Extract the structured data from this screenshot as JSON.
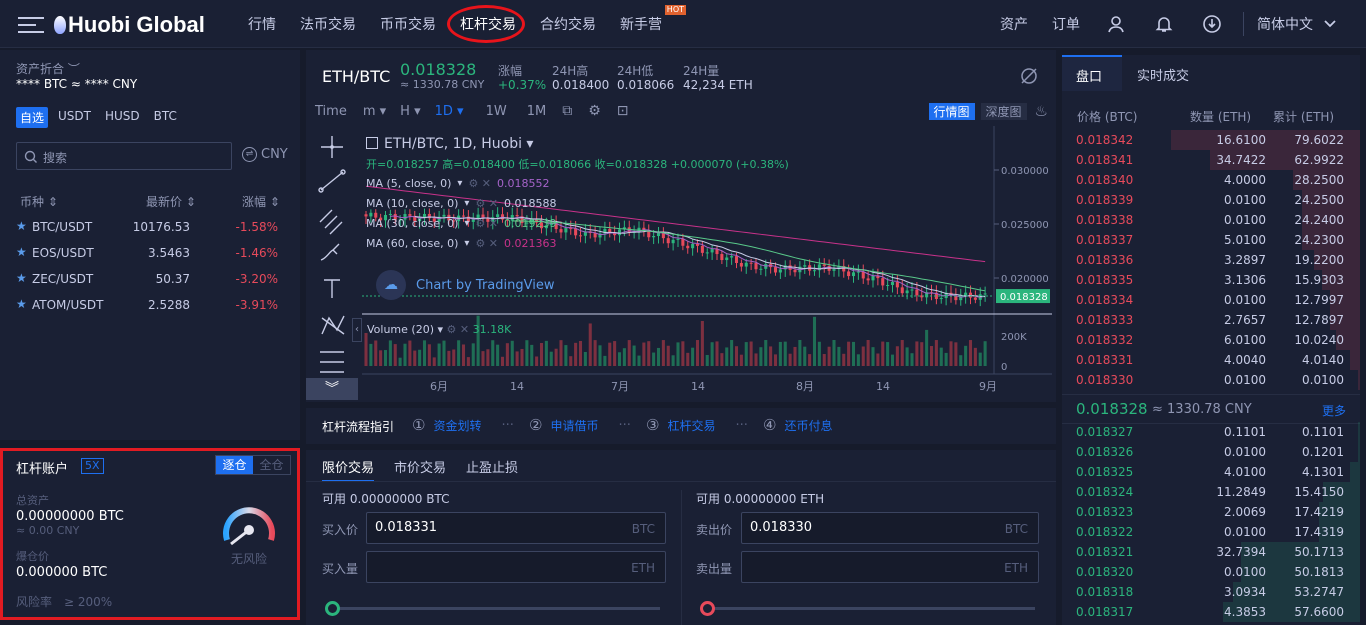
{
  "nav": {
    "brand": "Huobi Global",
    "links": [
      "行情",
      "法币交易",
      "币币交易",
      "杠杆交易",
      "合约交易",
      "新手营"
    ],
    "hot": "HOT",
    "right": [
      "资产",
      "订单"
    ],
    "lang": "简体中文"
  },
  "assets": {
    "title": "资产折合",
    "value": "**** BTC ≈ **** CNY"
  },
  "market": {
    "tabs": [
      "自选",
      "USDT",
      "HUSD",
      "BTC"
    ],
    "search_placeholder": "搜索",
    "currency": "CNY",
    "cols": [
      "币种",
      "最新价",
      "涨幅"
    ],
    "rows": [
      {
        "pair": "BTC/USDT",
        "price": "10176.53",
        "change": "-1.58%"
      },
      {
        "pair": "EOS/USDT",
        "price": "3.5463",
        "change": "-1.46%"
      },
      {
        "pair": "ZEC/USDT",
        "price": "50.37",
        "change": "-3.20%"
      },
      {
        "pair": "ATOM/USDT",
        "price": "2.5288",
        "change": "-3.91%"
      }
    ]
  },
  "leverage": {
    "title": "杠杆账户",
    "mult": "5X",
    "mode_on": "逐仓",
    "mode_off": "全仓",
    "total_label": "总资产",
    "total": "0.00000000 BTC",
    "total_cny": "≈ 0.00 CNY",
    "liq_label": "爆仓价",
    "liq": "0.000000 BTC",
    "risk_label": "风险率",
    "risk": "≥ 200%",
    "gauge_label": "无风险"
  },
  "ticker": {
    "pair": "ETH/BTC",
    "price": "0.018328",
    "cny": "≈ 1330.78 CNY",
    "chg_label": "涨幅",
    "chg": "+0.37%",
    "high_label": "24H高",
    "high": "0.018400",
    "low_label": "24H低",
    "low": "0.018066",
    "vol_label": "24H量",
    "vol": "42,234 ETH"
  },
  "toolbar": {
    "items": [
      "Time",
      "m",
      "H",
      "1D",
      "1W",
      "1M"
    ],
    "right_on": "行情图",
    "right_off": "深度图"
  },
  "chart": {
    "symbol": "ETH/BTC, 1D, Huobi",
    "ohlc": "开=0.018257 高=0.018400 低=0.018066 收=0.018328 +0.000070 (+0.38%)",
    "watermark": "Chart by TradingView",
    "ma": [
      {
        "label": "MA (5, close, 0)",
        "val": "0.018552",
        "color": "#a563c9"
      },
      {
        "label": "MA (10, close, 0)",
        "val": "0.018588",
        "color": "#c7cce6"
      },
      {
        "label": "MA (30, close, 0)",
        "val": "0.019239",
        "color": "#59c98a"
      },
      {
        "label": "MA (60, close, 0)",
        "val": "0.021363",
        "color": "#c8328a"
      }
    ],
    "vol_label": "Volume (20)",
    "vol_val": "31.18K",
    "y_ticks": [
      "0.030000",
      "0.025000",
      "0.020000"
    ],
    "price_tag": "0.018328",
    "vol_ticks": [
      "200K",
      "0"
    ],
    "x_ticks": [
      "6月",
      "14",
      "7月",
      "14",
      "8月",
      "14",
      "9月"
    ]
  },
  "guide": {
    "title": "杠杆流程指引",
    "steps": [
      {
        "n": "①",
        "t": "资金划转"
      },
      {
        "n": "②",
        "t": "申请借币"
      },
      {
        "n": "③",
        "t": "杠杆交易"
      },
      {
        "n": "④",
        "t": "还币付息"
      }
    ],
    "dots": "···"
  },
  "order": {
    "tabs": [
      "限价交易",
      "市价交易",
      "止盈止损"
    ],
    "avail_label": "可用",
    "buy_avail": "0.00000000",
    "buy_unit": "BTC",
    "sell_avail": "0.00000000",
    "sell_unit": "ETH",
    "buy_price_label": "买入价",
    "buy_price": "0.018331",
    "buy_qty_label": "买入量",
    "sell_price_label": "卖出价",
    "sell_price": "0.018330",
    "sell_qty_label": "卖出量",
    "unit_btc": "BTC",
    "unit_eth": "ETH"
  },
  "book": {
    "tabs": [
      "盘口",
      "实时成交"
    ],
    "cols": [
      "价格 (BTC)",
      "数量 (ETH)",
      "累计 (ETH)"
    ],
    "asks": [
      [
        "0.018342",
        "16.6100",
        "79.6022"
      ],
      [
        "0.018341",
        "34.7422",
        "62.9922"
      ],
      [
        "0.018340",
        "4.0000",
        "28.2500"
      ],
      [
        "0.018339",
        "0.0100",
        "24.2500"
      ],
      [
        "0.018338",
        "0.0100",
        "24.2400"
      ],
      [
        "0.018337",
        "5.0100",
        "24.2300"
      ],
      [
        "0.018336",
        "3.2897",
        "19.2200"
      ],
      [
        "0.018335",
        "3.1306",
        "15.9303"
      ],
      [
        "0.018334",
        "0.0100",
        "12.7997"
      ],
      [
        "0.018333",
        "2.7657",
        "12.7897"
      ],
      [
        "0.018332",
        "6.0100",
        "10.0240"
      ],
      [
        "0.018331",
        "4.0040",
        "4.0140"
      ],
      [
        "0.018330",
        "0.0100",
        "0.0100"
      ]
    ],
    "last": "0.018328",
    "last_cny": "≈ 1330.78 CNY",
    "more": "更多",
    "bids": [
      [
        "0.018327",
        "0.1101",
        "0.1101"
      ],
      [
        "0.018326",
        "0.0100",
        "0.1201"
      ],
      [
        "0.018325",
        "4.0100",
        "4.1301"
      ],
      [
        "0.018324",
        "11.2849",
        "15.4150"
      ],
      [
        "0.018323",
        "2.0069",
        "17.4219"
      ],
      [
        "0.018322",
        "0.0100",
        "17.4319"
      ],
      [
        "0.018321",
        "32.7394",
        "50.1713"
      ],
      [
        "0.018320",
        "0.0100",
        "50.1813"
      ],
      [
        "0.018318",
        "3.0934",
        "53.2747"
      ],
      [
        "0.018317",
        "4.3853",
        "57.6600"
      ]
    ]
  },
  "colors": {
    "red": "#e74a5b",
    "green": "#2bb57d",
    "accent": "#1e6ff0",
    "highlight": "#e8141b"
  }
}
